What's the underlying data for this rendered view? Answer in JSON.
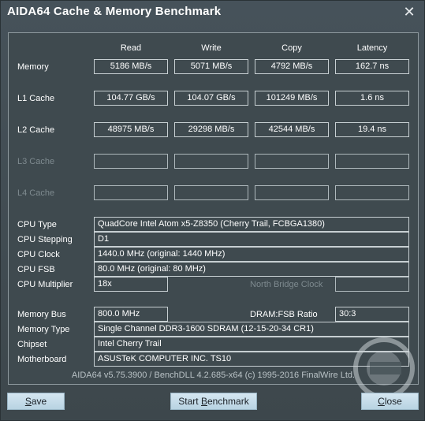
{
  "window": {
    "title": "AIDA64 Cache & Memory Benchmark",
    "close_glyph": "✕"
  },
  "columns": {
    "read": "Read",
    "write": "Write",
    "copy": "Copy",
    "latency": "Latency"
  },
  "rows": {
    "memory": {
      "label": "Memory",
      "read": "5186 MB/s",
      "write": "5071 MB/s",
      "copy": "4792 MB/s",
      "latency": "162.7 ns"
    },
    "l1": {
      "label": "L1 Cache",
      "read": "104.77 GB/s",
      "write": "104.07 GB/s",
      "copy": "101249 MB/s",
      "latency": "1.6 ns"
    },
    "l2": {
      "label": "L2 Cache",
      "read": "48975 MB/s",
      "write": "29298 MB/s",
      "copy": "42544 MB/s",
      "latency": "19.4 ns"
    },
    "l3": {
      "label": "L3 Cache"
    },
    "l4": {
      "label": "L4 Cache"
    }
  },
  "info": {
    "cpu_type_label": "CPU Type",
    "cpu_type": "QuadCore Intel Atom x5-Z8350  (Cherry Trail, FCBGA1380)",
    "cpu_stepping_label": "CPU Stepping",
    "cpu_stepping": "D1",
    "cpu_clock_label": "CPU Clock",
    "cpu_clock": "1440.0 MHz  (original: 1440 MHz)",
    "cpu_fsb_label": "CPU FSB",
    "cpu_fsb": "80.0 MHz  (original: 80 MHz)",
    "cpu_multiplier_label": "CPU Multiplier",
    "cpu_multiplier": "18x",
    "north_bridge_label": "North Bridge Clock",
    "memory_bus_label": "Memory Bus",
    "memory_bus": "800.0 MHz",
    "dram_fsb_label": "DRAM:FSB Ratio",
    "dram_fsb": "30:3",
    "memory_type_label": "Memory Type",
    "memory_type": "Single Channel DDR3-1600 SDRAM  (12-15-20-34 CR1)",
    "chipset_label": "Chipset",
    "chipset": "Intel Cherry Trail",
    "motherboard_label": "Motherboard",
    "motherboard": "ASUSTeK COMPUTER INC. TS10"
  },
  "footer": "AIDA64 v5.75.3900 / BenchDLL 4.2.685-x64  (c) 1995-2016 FinalWire Ltd.",
  "buttons": {
    "save_accel": "S",
    "save_rest": "ave",
    "start_pre": "Start ",
    "start_accel": "B",
    "start_rest": "enchmark",
    "close_accel": "C",
    "close_rest": "lose"
  },
  "colors": {
    "background": "#3f4a4d",
    "button": "#c7dde9",
    "border": "#c7cfd2",
    "dim_label": "#7e8a8f"
  }
}
